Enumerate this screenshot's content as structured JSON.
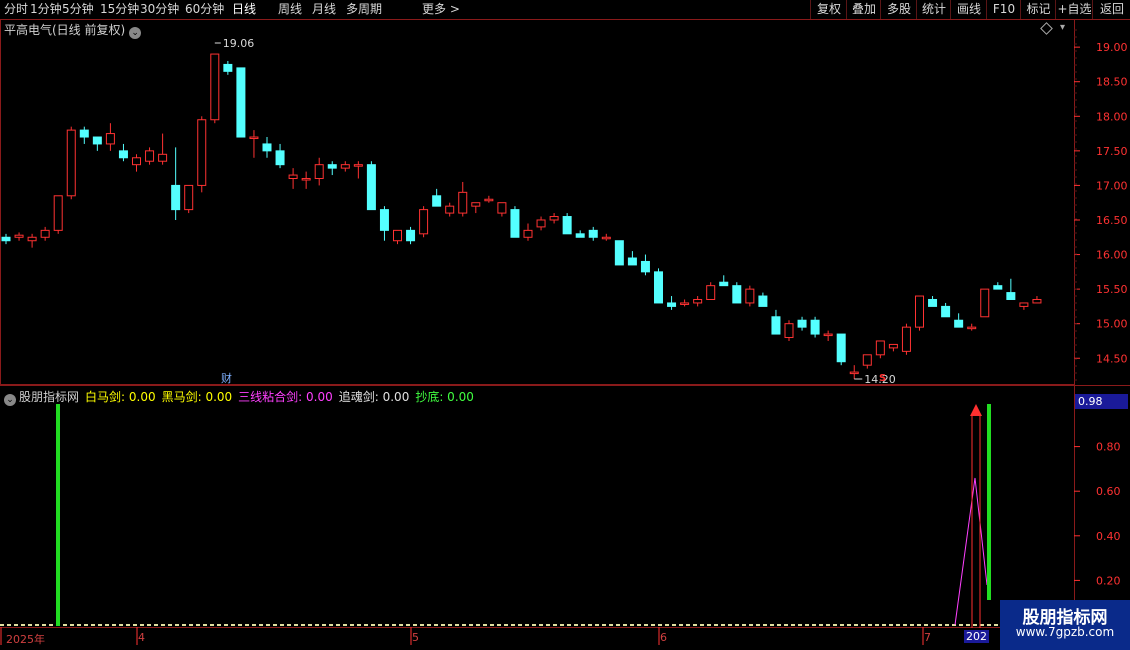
{
  "toolbar": {
    "periods": [
      "分时",
      "1分钟",
      "5分钟",
      "15分钟",
      "30分钟",
      "60分钟",
      "日线",
      "周线",
      "月线",
      "多周期",
      "更多 >"
    ],
    "active": "日线",
    "right_buttons": [
      "复权",
      "叠加",
      "多股",
      "统计",
      "画线",
      "F10",
      "标记",
      "+自选",
      "返回"
    ]
  },
  "main_chart": {
    "title": "平高电气(日线 前复权)",
    "high_label": "19.06",
    "low_label": "14.20",
    "finance_marker": "财",
    "signal_marker": "S"
  },
  "sub_chart": {
    "title": "股朋指标网",
    "indicators": [
      {
        "label": "白马剑:",
        "value": "0.00",
        "color": "#ffff00"
      },
      {
        "label": "黑马剑:",
        "value": "0.00",
        "color": "#ffff00"
      },
      {
        "label": "三线粘合剑:",
        "value": "0.00",
        "color": "#ff40ff"
      },
      {
        "label": "追魂剑:",
        "value": "0.00",
        "color": "#e0e0e0"
      },
      {
        "label": "抄底:",
        "value": "0.00",
        "color": "#40ff40"
      }
    ],
    "value_box": "0.98"
  },
  "x_axis": {
    "dates": [
      "2025年",
      "4",
      "5",
      "6",
      "7"
    ],
    "current": "202"
  },
  "watermark": {
    "title": "股朋指标网",
    "url": "www.7gpzb.com"
  },
  "colors": {
    "up": "#ff3232",
    "down": "#54ffff",
    "frame": "#8a1a1a",
    "grid": "#5a1515"
  },
  "chart_data": [
    {
      "type": "candlestick",
      "title": "平高电气(日线 前复权)",
      "ylim": [
        14.1,
        19.2
      ],
      "y_ticks": [
        19.0,
        18.5,
        18.0,
        17.5,
        17.0,
        16.5,
        16.0,
        15.5,
        15.0,
        14.5
      ],
      "candles": [
        [
          16.25,
          16.3,
          16.15,
          16.2
        ],
        [
          16.25,
          16.32,
          16.2,
          16.28
        ],
        [
          16.2,
          16.3,
          16.1,
          16.25
        ],
        [
          16.25,
          16.4,
          16.2,
          16.35
        ],
        [
          16.35,
          16.85,
          16.3,
          16.85
        ],
        [
          16.85,
          17.85,
          16.8,
          17.8
        ],
        [
          17.8,
          17.85,
          17.6,
          17.7
        ],
        [
          17.7,
          17.7,
          17.5,
          17.6
        ],
        [
          17.6,
          17.9,
          17.5,
          17.75
        ],
        [
          17.5,
          17.6,
          17.35,
          17.4
        ],
        [
          17.3,
          17.45,
          17.2,
          17.4
        ],
        [
          17.35,
          17.55,
          17.3,
          17.5
        ],
        [
          17.35,
          17.75,
          17.3,
          17.45
        ],
        [
          17.0,
          17.55,
          16.5,
          16.65
        ],
        [
          16.65,
          17.0,
          16.6,
          17.0
        ],
        [
          17.0,
          18.0,
          16.9,
          17.95
        ],
        [
          17.95,
          18.9,
          17.9,
          18.9
        ],
        [
          18.75,
          18.8,
          18.6,
          18.65
        ],
        [
          18.7,
          18.7,
          17.7,
          17.7
        ],
        [
          17.7,
          17.8,
          17.4,
          17.7
        ],
        [
          17.6,
          17.7,
          17.4,
          17.5
        ],
        [
          17.5,
          17.6,
          17.25,
          17.3
        ],
        [
          17.1,
          17.25,
          16.95,
          17.15
        ],
        [
          17.1,
          17.2,
          16.95,
          17.1
        ],
        [
          17.1,
          17.4,
          17.0,
          17.3
        ],
        [
          17.3,
          17.35,
          17.15,
          17.25
        ],
        [
          17.25,
          17.35,
          17.2,
          17.3
        ],
        [
          17.3,
          17.35,
          17.1,
          17.3
        ],
        [
          17.3,
          17.35,
          16.65,
          16.65
        ],
        [
          16.65,
          16.7,
          16.2,
          16.35
        ],
        [
          16.2,
          16.35,
          16.15,
          16.35
        ],
        [
          16.35,
          16.4,
          16.15,
          16.2
        ],
        [
          16.3,
          16.7,
          16.25,
          16.65
        ],
        [
          16.85,
          16.95,
          16.7,
          16.7
        ],
        [
          16.6,
          16.75,
          16.55,
          16.7
        ],
        [
          16.6,
          17.05,
          16.55,
          16.9
        ],
        [
          16.7,
          16.75,
          16.6,
          16.75
        ],
        [
          16.8,
          16.85,
          16.75,
          16.8
        ],
        [
          16.6,
          16.75,
          16.55,
          16.75
        ],
        [
          16.65,
          16.7,
          16.25,
          16.25
        ],
        [
          16.25,
          16.45,
          16.2,
          16.35
        ],
        [
          16.4,
          16.55,
          16.35,
          16.5
        ],
        [
          16.5,
          16.6,
          16.45,
          16.55
        ],
        [
          16.55,
          16.6,
          16.3,
          16.3
        ],
        [
          16.3,
          16.35,
          16.25,
          16.25
        ],
        [
          16.35,
          16.4,
          16.2,
          16.25
        ],
        [
          16.25,
          16.3,
          16.2,
          16.25
        ],
        [
          16.2,
          16.2,
          15.85,
          15.85
        ],
        [
          15.95,
          16.05,
          15.85,
          15.85
        ],
        [
          15.9,
          16.0,
          15.7,
          15.75
        ],
        [
          15.75,
          15.8,
          15.3,
          15.3
        ],
        [
          15.3,
          15.4,
          15.2,
          15.25
        ],
        [
          15.3,
          15.35,
          15.25,
          15.3
        ],
        [
          15.3,
          15.4,
          15.25,
          15.35
        ],
        [
          15.35,
          15.6,
          15.35,
          15.55
        ],
        [
          15.6,
          15.7,
          15.55,
          15.55
        ],
        [
          15.55,
          15.6,
          15.3,
          15.3
        ],
        [
          15.3,
          15.55,
          15.25,
          15.5
        ],
        [
          15.4,
          15.45,
          15.25,
          15.25
        ],
        [
          15.1,
          15.2,
          14.85,
          14.85
        ],
        [
          14.8,
          15.05,
          14.75,
          15.0
        ],
        [
          15.05,
          15.1,
          14.9,
          14.95
        ],
        [
          15.05,
          15.1,
          14.8,
          14.85
        ],
        [
          14.85,
          14.9,
          14.75,
          14.85
        ],
        [
          14.85,
          14.85,
          14.4,
          14.45
        ],
        [
          14.3,
          14.4,
          14.2,
          14.3
        ],
        [
          14.4,
          14.55,
          14.35,
          14.55
        ],
        [
          14.55,
          14.75,
          14.5,
          14.75
        ],
        [
          14.65,
          14.7,
          14.6,
          14.7
        ],
        [
          14.6,
          15.0,
          14.55,
          14.95
        ],
        [
          14.95,
          15.4,
          14.9,
          15.4
        ],
        [
          15.35,
          15.4,
          15.25,
          15.25
        ],
        [
          15.25,
          15.3,
          15.1,
          15.1
        ],
        [
          15.05,
          15.15,
          14.95,
          14.95
        ],
        [
          14.95,
          15.0,
          14.9,
          14.95
        ],
        [
          15.1,
          15.5,
          15.1,
          15.5
        ],
        [
          15.55,
          15.6,
          15.5,
          15.5
        ],
        [
          15.45,
          15.65,
          15.35,
          15.35
        ],
        [
          15.25,
          15.3,
          15.2,
          15.3
        ],
        [
          15.3,
          15.4,
          15.3,
          15.35
        ]
      ]
    },
    {
      "type": "line",
      "title": "股朋指标网",
      "ylim": [
        0,
        1.0
      ],
      "y_ticks": [
        0.98,
        0.8,
        0.6,
        0.4,
        0.2
      ],
      "series": [
        {
          "name": "白马剑",
          "value": 0.0
        },
        {
          "name": "黑马剑",
          "value": 0.0
        },
        {
          "name": "三线粘合剑",
          "value": 0.0
        },
        {
          "name": "追魂剑",
          "value": 0.0
        },
        {
          "name": "抄底",
          "value": 0.0
        }
      ]
    }
  ]
}
